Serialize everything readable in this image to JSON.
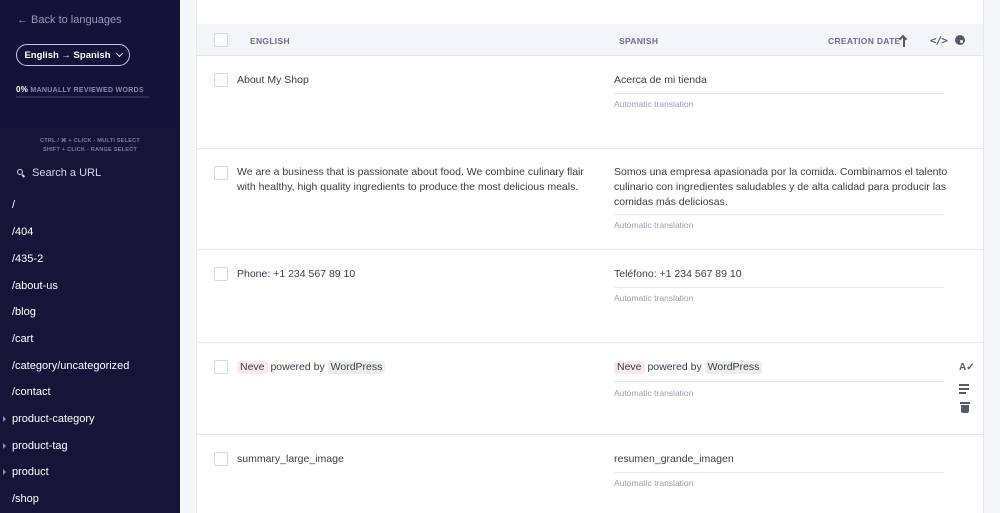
{
  "sidebar": {
    "back_label": "← Back to languages",
    "language_pair": "English → Spanish",
    "reviewed_pct": "0%",
    "reviewed_label": "MANUALLY REVIEWED WORDS",
    "reviewed_fraction": 0,
    "shortcut_multi": "CTRL / ⌘ + CLICK - MULTI SELECT",
    "shortcut_range": "SHIFT + CLICK - RANGE SELECT",
    "search_placeholder": "Search a URL",
    "urls": [
      {
        "label": "/",
        "expandable": false
      },
      {
        "label": "/404",
        "expandable": false
      },
      {
        "label": "/435-2",
        "expandable": false
      },
      {
        "label": "/about-us",
        "expandable": false
      },
      {
        "label": "/blog",
        "expandable": false
      },
      {
        "label": "/cart",
        "expandable": false
      },
      {
        "label": "/category/uncategorized",
        "expandable": false
      },
      {
        "label": "/contact",
        "expandable": false
      },
      {
        "label": "product-category",
        "expandable": true
      },
      {
        "label": "product-tag",
        "expandable": true
      },
      {
        "label": "product",
        "expandable": true
      },
      {
        "label": "/shop",
        "expandable": false
      }
    ]
  },
  "table": {
    "col_source": "ENGLISH",
    "col_target": "SPANISH",
    "col_date": "CREATION DATE",
    "rows": [
      {
        "source": "About My Shop",
        "target": "Acerca de mi tienda",
        "status": "Automatic translation"
      },
      {
        "source": "We are a business that is passionate about food. We combine culinary flair with healthy, high quality ingredients to produce the most delicious meals.",
        "target": "Somos una empresa apasionada por la comida. Combinamos el talento culinario con ingredientes saludables y de alta calidad para producir las comidas más deliciosas.",
        "status": "Automatic translation"
      },
      {
        "source": "Phone: +1 234 567 89 10",
        "target": "Teléfono: +1 234 567 89 10",
        "status": "Automatic translation"
      },
      {
        "source_tag1": "Neve",
        "source_mid": "powered by",
        "source_tag2": "WordPress",
        "target_tag1": "Neve",
        "target_mid": "powered by",
        "target_tag2": "WordPress",
        "status": "Automatic translation"
      },
      {
        "source": "summary_large_image",
        "target": "resumen_grande_imagen",
        "status": "Automatic translation"
      }
    ]
  },
  "icons": {
    "sort": "arrow-up-icon",
    "code": "code-icon",
    "palette": "palette-icon",
    "spellcheck": "spellcheck-icon",
    "list": "list-icon",
    "delete": "trash-icon"
  },
  "colors": {
    "sidebar_bg": "#15153a",
    "main_bg": "#f6f7f9",
    "header_bg": "#f4f5f8"
  }
}
